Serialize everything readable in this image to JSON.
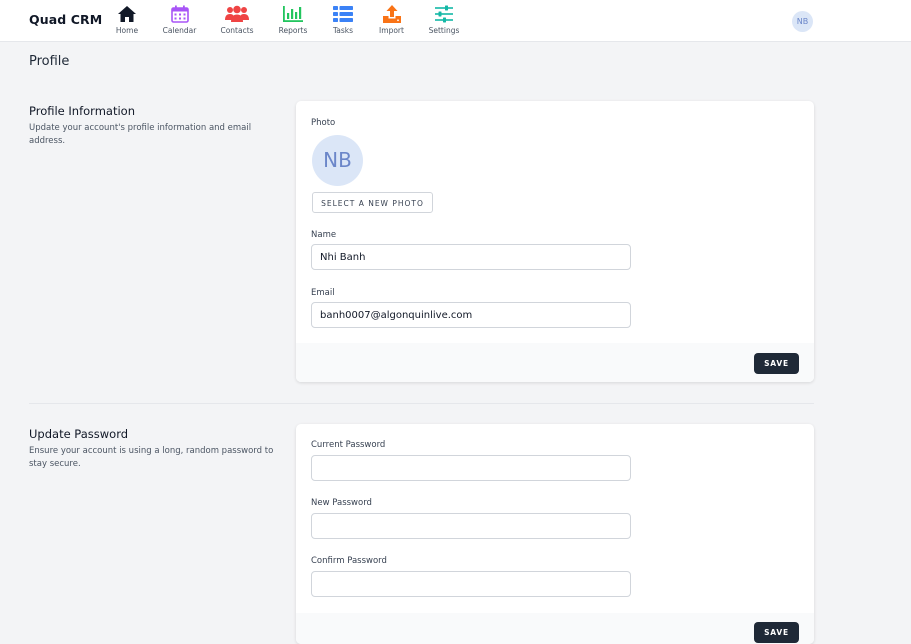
{
  "app": {
    "brand": "Quad CRM",
    "user_initials": "NB"
  },
  "nav": [
    {
      "label": "Home",
      "icon": "home-icon",
      "color": "#111827"
    },
    {
      "label": "Calendar",
      "icon": "calendar-icon",
      "color": "#a855f7"
    },
    {
      "label": "Contacts",
      "icon": "users-icon",
      "color": "#ef4444"
    },
    {
      "label": "Reports",
      "icon": "chart-icon",
      "color": "#22c55e"
    },
    {
      "label": "Tasks",
      "icon": "list-icon",
      "color": "#3b82f6"
    },
    {
      "label": "Import",
      "icon": "upload-icon",
      "color": "#f97316"
    },
    {
      "label": "Settings",
      "icon": "sliders-icon",
      "color": "#14b8a6"
    }
  ],
  "page": {
    "title": "Profile"
  },
  "profile_info": {
    "title": "Profile Information",
    "description": "Update your account's profile information and email address.",
    "photo_label": "Photo",
    "photo_initials": "NB",
    "select_photo_label": "SELECT A NEW PHOTO",
    "name_label": "Name",
    "name_value": "Nhi Banh",
    "email_label": "Email",
    "email_value": "banh0007@algonquinlive.com",
    "save_label": "SAVE"
  },
  "update_password": {
    "title": "Update Password",
    "description": "Ensure your account is using a long, random password to stay secure.",
    "current_label": "Current Password",
    "current_value": "",
    "new_label": "New Password",
    "new_value": "",
    "confirm_label": "Confirm Password",
    "confirm_value": "",
    "save_label": "SAVE"
  }
}
